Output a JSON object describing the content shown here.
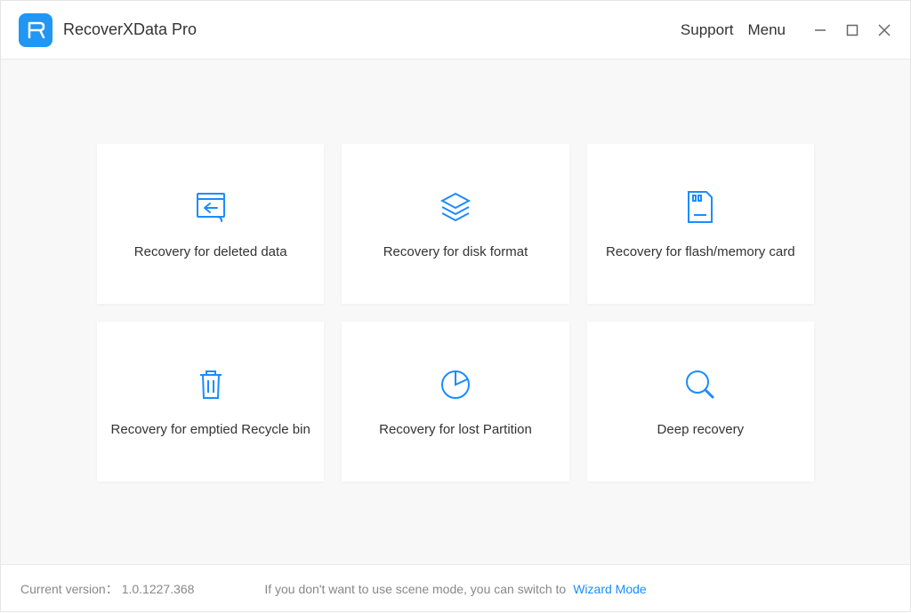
{
  "app": {
    "title": "RecoverXData Pro"
  },
  "titlebar": {
    "support": "Support",
    "menu": "Menu"
  },
  "cards": [
    {
      "label": "Recovery for deleted data"
    },
    {
      "label": "Recovery for disk format"
    },
    {
      "label": "Recovery for flash/memory card"
    },
    {
      "label": "Recovery for emptied Recycle bin"
    },
    {
      "label": "Recovery for lost Partition"
    },
    {
      "label": "Deep recovery"
    }
  ],
  "footer": {
    "version_label": "Current version：",
    "version_value": "1.0.1227.368",
    "hint": "If you don't want to use scene mode, you can switch to",
    "link": "Wizard Mode"
  }
}
